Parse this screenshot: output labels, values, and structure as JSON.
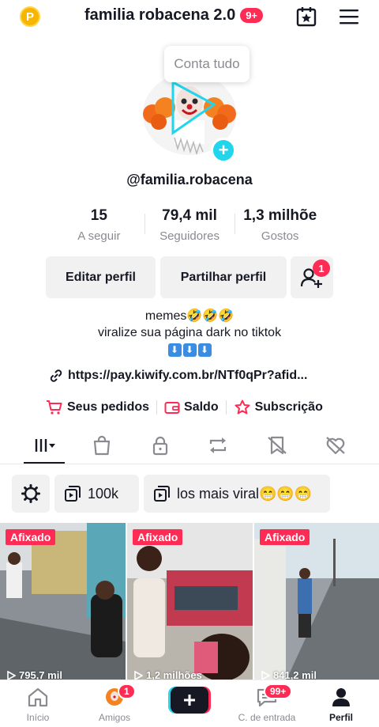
{
  "header": {
    "coin_label": "P",
    "title": "familia robacena 2.0",
    "title_badge": "9+"
  },
  "profile": {
    "tooltip": "Conta tudo",
    "username": "@familia.robacena"
  },
  "stats": [
    {
      "value": "15",
      "label": "A seguir"
    },
    {
      "value": "79,4 mil",
      "label": "Seguidores"
    },
    {
      "value": "1,3 milhõe",
      "label": "Gostos"
    }
  ],
  "buttons": {
    "edit": "Editar perfil",
    "share": "Partilhar perfil",
    "friend_badge": "1"
  },
  "bio": {
    "line1": "memes🤣🤣🤣",
    "line2": "viralize sua página dark no tiktok",
    "arrows": [
      "⬇",
      "⬇",
      "⬇"
    ],
    "link": "https://pay.kiwify.com.br/NTf0qPr?afid..."
  },
  "shop": {
    "orders": "Seus pedidos",
    "balance": "Saldo",
    "subscription": "Subscrição"
  },
  "playlists": {
    "chip1": "100k",
    "chip2": "los mais viral😁😁😁"
  },
  "videos": [
    {
      "pin": "Afixado",
      "views": "795,7 mil"
    },
    {
      "pin": "Afixado",
      "views": "1,2 milhões"
    },
    {
      "pin": "Afixado",
      "views": "841,2 mil"
    }
  ],
  "nav": {
    "home": "Início",
    "friends": "Amigos",
    "friends_badge": "1",
    "inbox": "C. de entrada",
    "inbox_badge": "99+",
    "profile": "Perfil"
  },
  "colors": {
    "accent": "#fe2c55",
    "cyan": "#20d5ec",
    "chip_bg": "#f1f1f2"
  }
}
